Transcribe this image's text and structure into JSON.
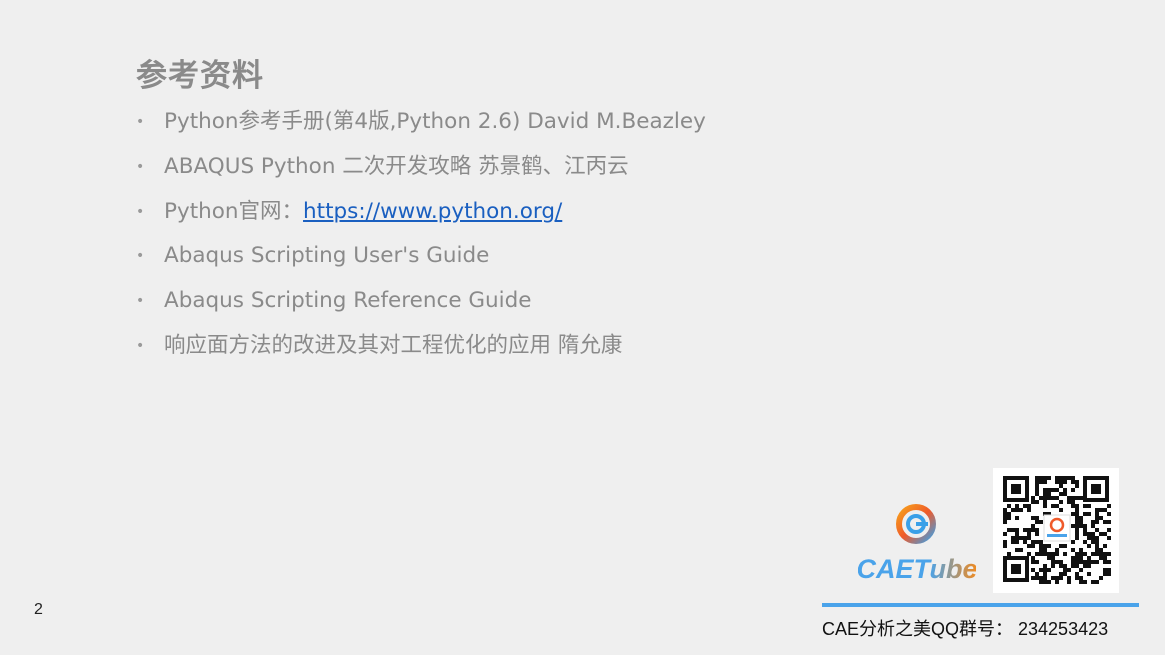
{
  "slide": {
    "title": "参考资料",
    "bullet_symbol": "•",
    "items": [
      {
        "text": "Python参考手册(第4版,Python 2.6) David M.Beazley"
      },
      {
        "text": "ABAQUS Python 二次开发攻略 苏景鹤、江丙云"
      },
      {
        "prefix": "Python官网：",
        "link": "https://www.python.org/"
      },
      {
        "text": "Abaqus Scripting User's Guide"
      },
      {
        "text": "Abaqus Scripting Reference Guide"
      },
      {
        "text": "响应面方法的改进及其对工程优化的应用  隋允康"
      }
    ],
    "page_number": "2"
  },
  "branding": {
    "logo_icon": "cae-tube-logo-icon",
    "logo_text": "CAETube",
    "qr_icon": "qr-code-icon",
    "footer_text": "CAE分析之美QQ群号： 234253423",
    "colors": {
      "accent_blue": "#4aa3ea",
      "accent_orange": "#f28a1e",
      "link_blue": "#1a5fc0"
    }
  }
}
